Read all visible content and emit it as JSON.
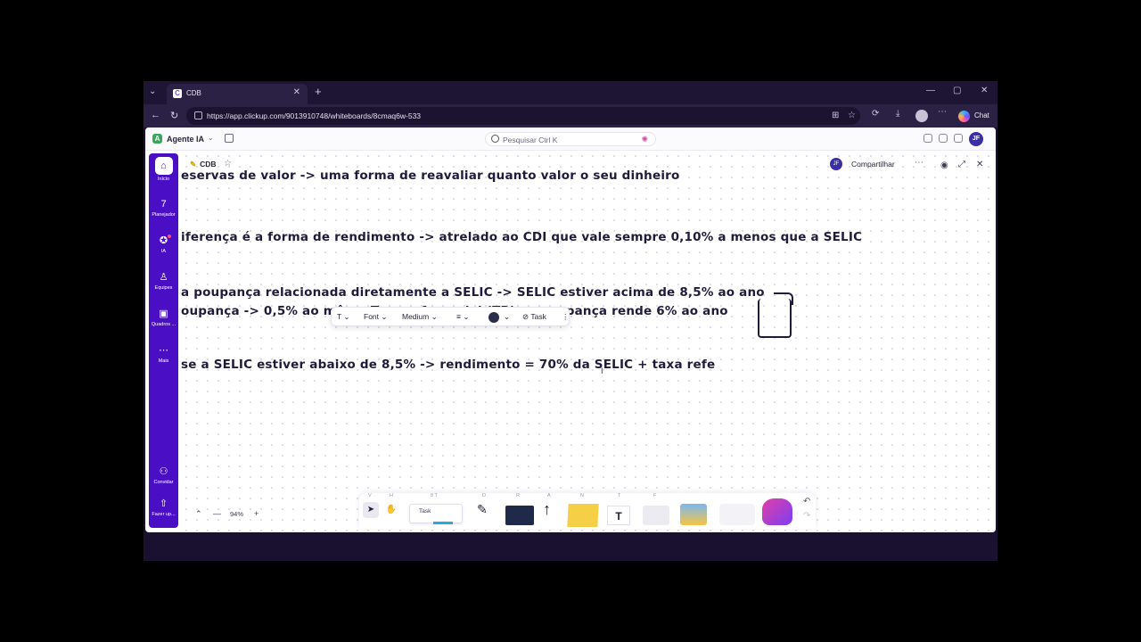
{
  "browser": {
    "tab_menu_glyph": "⌄",
    "tab_title": "CDB",
    "tab_favicon_letter": "C",
    "tab_close": "✕",
    "new_tab": "+",
    "minimize": "—",
    "maximize": "▢",
    "close": "✕",
    "back": "←",
    "reload": "↻",
    "url": "https://app.clickup.com/9013910748/whiteboards/8cmaq6w-533",
    "chat_label": "Chat"
  },
  "topbar": {
    "workspace_initial": "A",
    "workspace_name": "Agente IA",
    "workspace_chevron": "⌄",
    "search_placeholder": "Pesquisar Ctrl K",
    "user_initials": "JF"
  },
  "sidebar": {
    "items": [
      {
        "label": "Início",
        "glyph": "⌂"
      },
      {
        "label": "Planejador",
        "glyph": "7"
      },
      {
        "label": "IA",
        "glyph": "✪"
      },
      {
        "label": "Equipes",
        "glyph": "♙"
      },
      {
        "label": "Quadros ...",
        "glyph": "▣"
      },
      {
        "label": "Mais",
        "glyph": "⋯"
      },
      {
        "label": "Convidar",
        "glyph": "⚇"
      },
      {
        "label": "Fazer up...",
        "glyph": "⇧"
      }
    ]
  },
  "board": {
    "title": "CDB",
    "share_initials": "JF",
    "share_label": "Compartilhar",
    "more": "⋯",
    "expand": "⤢",
    "close": "✕",
    "lines": [
      "eservas de valor -> uma forma de reavaliar quanto valor o seu dinheiro",
      "iferença é a forma de rendimento -> atrelado ao CDI que vale sempre 0,10% a menos que a SELIC",
      "a poupança relacionada diretamente a SELIC -> SELIC estiver acima de 8,5% ao ano",
      "oupança -> 0,5% ao mês + Taxa referencial (TR) -> poupança rende 6% ao ano",
      "se a SELIC estiver abaixo de 8,5% -> rendimento = 70% da SELIC + taxa refe"
    ]
  },
  "text_toolbar": {
    "type_glyph": "T",
    "font_label": "Font",
    "size_label": "Medium",
    "align_glyph": "≡",
    "color": "#2a2d4a",
    "task_label": "Task",
    "more": "⋮"
  },
  "zoom": {
    "collapse": "⌃",
    "minus": "—",
    "value": "94%",
    "plus": "+"
  },
  "bottom_toolbar": {
    "key_hints": [
      "V",
      "H",
      "8 T",
      "D",
      "R",
      "A",
      "N",
      "T",
      "F"
    ],
    "cursor_glyph": "➤",
    "hand_glyph": "✋",
    "task_label": "Task",
    "pen_glyph": "✎",
    "arrow_glyph": "↑",
    "text_glyph": "T",
    "undo_glyph": "↶",
    "redo_glyph": "↷"
  }
}
